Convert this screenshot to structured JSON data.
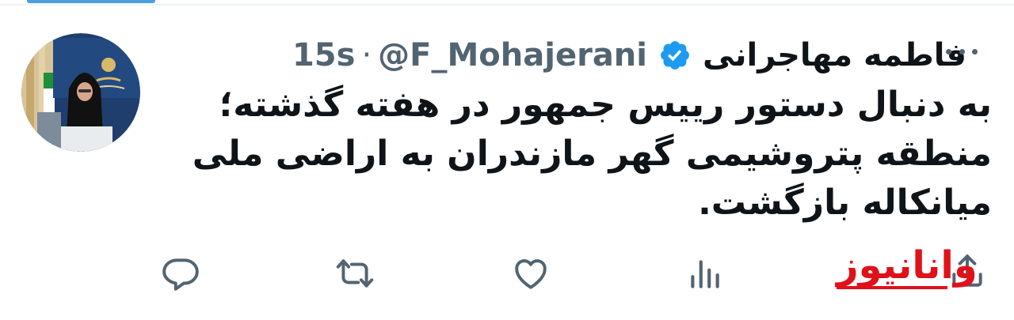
{
  "tweet": {
    "author": {
      "display_name": "فاطمه مهاجرانی",
      "handle": "@F_Mohajerani",
      "verified": true,
      "avatar_icon": "profile-photo"
    },
    "separator": "·",
    "time": "15s",
    "text_lines": [
      "به دنبال دستور رییس جمهور در هفته گذشته؛",
      "منطقه پتروشیمی گهر مازندران به اراضی ملی",
      "میانکاله بازگشت."
    ]
  },
  "actions": {
    "reply_icon": "reply-icon",
    "retweet_icon": "retweet-icon",
    "like_icon": "like-icon",
    "views_icon": "views-icon",
    "share_icon": "share-icon"
  },
  "watermark": {
    "text": "وانانیوز"
  },
  "colors": {
    "accent_blue": "#1d9bf0",
    "secondary_text": "#536471",
    "primary_text": "#0f1419",
    "watermark_red": "#e0111a"
  }
}
